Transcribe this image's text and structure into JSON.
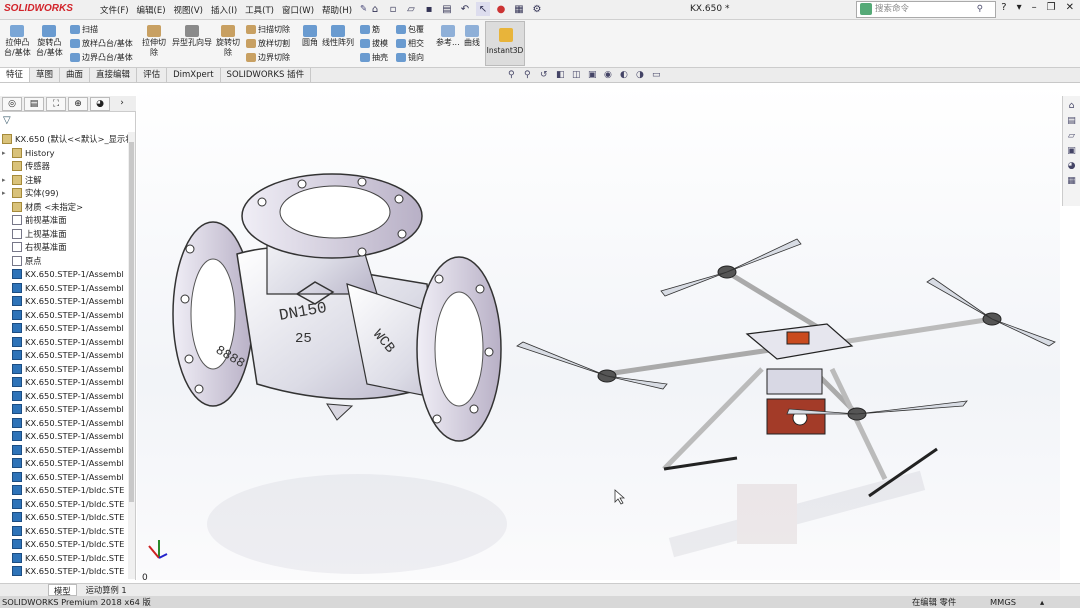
{
  "app": {
    "logo": "SOLIDWORKS",
    "doc_title": "KX.650 *"
  },
  "menu": [
    "文件(F)",
    "编辑(E)",
    "视图(V)",
    "插入(I)",
    "工具(T)",
    "窗口(W)",
    "帮助(H)"
  ],
  "search": {
    "placeholder": "搜索命令"
  },
  "commands": {
    "extrude": "拉伸凸\n台/基体",
    "revolve": "旋转凸\n台/基体",
    "sweep": "扫描",
    "loft": "放样凸台/基体",
    "boundary": "边界凸台/基体",
    "extrude_cut": "拉伸切\n除",
    "hole_wizard": "异型孔向导",
    "revolve_cut": "旋转切\n除",
    "sweep_cut": "扫描切除",
    "loft_cut": "放样切割",
    "boundary_cut": "边界切除",
    "fillet": "圆角",
    "linear_pattern": "线性阵列",
    "rib": "筋",
    "draft": "拔模",
    "shell": "抽壳",
    "wrap": "包覆",
    "intersect": "相交",
    "mirror": "镜向",
    "reference": "参考...",
    "curves": "曲线",
    "instant3d": "Instant3D"
  },
  "tabs": [
    "特征",
    "草图",
    "曲面",
    "直接编辑",
    "评估",
    "DimXpert",
    "SOLIDWORKS 插件"
  ],
  "tree": {
    "root": "KX.650 (默认<<默认>_显示状",
    "items": [
      {
        "label": "History",
        "type": "folder",
        "expand": "▸"
      },
      {
        "label": "传感器",
        "type": "folder",
        "expand": ""
      },
      {
        "label": "注解",
        "type": "folder",
        "expand": "▸"
      },
      {
        "label": "实体(99)",
        "type": "folder",
        "expand": "▸"
      },
      {
        "label": "材质 <未指定>",
        "type": "folder",
        "expand": ""
      },
      {
        "label": "前视基准面",
        "type": "plane",
        "expand": ""
      },
      {
        "label": "上视基准面",
        "type": "plane",
        "expand": ""
      },
      {
        "label": "右视基准面",
        "type": "plane",
        "expand": ""
      },
      {
        "label": "原点",
        "type": "plane",
        "expand": ""
      },
      {
        "label": "KX.650.STEP-1/Assembl",
        "type": "part",
        "expand": ""
      },
      {
        "label": "KX.650.STEP-1/Assembl",
        "type": "part",
        "expand": ""
      },
      {
        "label": "KX.650.STEP-1/Assembl",
        "type": "part",
        "expand": ""
      },
      {
        "label": "KX.650.STEP-1/Assembl",
        "type": "part",
        "expand": ""
      },
      {
        "label": "KX.650.STEP-1/Assembl",
        "type": "part",
        "expand": ""
      },
      {
        "label": "KX.650.STEP-1/Assembl",
        "type": "part",
        "expand": ""
      },
      {
        "label": "KX.650.STEP-1/Assembl",
        "type": "part",
        "expand": ""
      },
      {
        "label": "KX.650.STEP-1/Assembl",
        "type": "part",
        "expand": ""
      },
      {
        "label": "KX.650.STEP-1/Assembl",
        "type": "part",
        "expand": ""
      },
      {
        "label": "KX.650.STEP-1/Assembl",
        "type": "part",
        "expand": ""
      },
      {
        "label": "KX.650.STEP-1/Assembl",
        "type": "part",
        "expand": ""
      },
      {
        "label": "KX.650.STEP-1/Assembl",
        "type": "part",
        "expand": ""
      },
      {
        "label": "KX.650.STEP-1/Assembl",
        "type": "part",
        "expand": ""
      },
      {
        "label": "KX.650.STEP-1/Assembl",
        "type": "part",
        "expand": ""
      },
      {
        "label": "KX.650.STEP-1/Assembl",
        "type": "part",
        "expand": ""
      },
      {
        "label": "KX.650.STEP-1/Assembl",
        "type": "part",
        "expand": ""
      },
      {
        "label": "KX.650.STEP-1/bldc.STE",
        "type": "part",
        "expand": ""
      },
      {
        "label": "KX.650.STEP-1/bldc.STE",
        "type": "part",
        "expand": ""
      },
      {
        "label": "KX.650.STEP-1/bldc.STE",
        "type": "part",
        "expand": ""
      },
      {
        "label": "KX.650.STEP-1/bldc.STE",
        "type": "part",
        "expand": ""
      },
      {
        "label": "KX.650.STEP-1/bldc.STE",
        "type": "part",
        "expand": ""
      },
      {
        "label": "KX.650.STEP-1/bldc.STE",
        "type": "part",
        "expand": ""
      },
      {
        "label": "KX.650.STEP-1/bldc.STE",
        "type": "part",
        "expand": ""
      }
    ]
  },
  "valve": {
    "size": "DN150",
    "pressure": "25",
    "material": "WCB",
    "mark": "8888"
  },
  "triad_label": "0",
  "bottom_tabs": [
    "模型",
    "运动算例 1"
  ],
  "status": {
    "left": "SOLIDWORKS Premium 2018 x64 版",
    "mode": "在编辑 零件",
    "units": "MMGS",
    "arrow": "▴"
  }
}
